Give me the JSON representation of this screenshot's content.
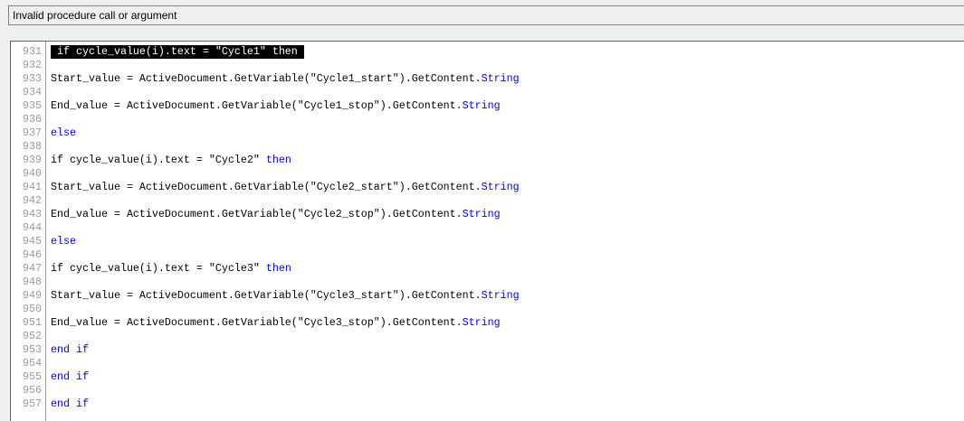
{
  "error_message": "Invalid procedure call or argument",
  "editor": {
    "highlighted_line": 931,
    "lines": [
      {
        "n": "931",
        "hl": true,
        "tokens": [
          {
            "t": " if cycle_value(i).text = \"Cycle1\" then ",
            "k": false
          }
        ]
      },
      {
        "n": "932",
        "tokens": []
      },
      {
        "n": "933",
        "tokens": [
          {
            "t": "Start_value = ActiveDocument.GetVariable(\"Cycle1_start\").GetContent.",
            "k": false
          },
          {
            "t": "String",
            "k": true
          }
        ]
      },
      {
        "n": "934",
        "tokens": []
      },
      {
        "n": "935",
        "tokens": [
          {
            "t": "End_value = ActiveDocument.GetVariable(\"Cycle1_stop\").GetContent.",
            "k": false
          },
          {
            "t": "String",
            "k": true
          }
        ]
      },
      {
        "n": "936",
        "tokens": []
      },
      {
        "n": "937",
        "tokens": [
          {
            "t": "else",
            "k": true
          }
        ]
      },
      {
        "n": "938",
        "tokens": []
      },
      {
        "n": "939",
        "tokens": [
          {
            "t": "if cycle_value(i).text = \"Cycle2\" ",
            "k": false
          },
          {
            "t": "then",
            "k": true
          }
        ]
      },
      {
        "n": "940",
        "tokens": []
      },
      {
        "n": "941",
        "tokens": [
          {
            "t": "Start_value = ActiveDocument.GetVariable(\"Cycle2_start\").GetContent.",
            "k": false
          },
          {
            "t": "String",
            "k": true
          }
        ]
      },
      {
        "n": "942",
        "tokens": []
      },
      {
        "n": "943",
        "tokens": [
          {
            "t": "End_value = ActiveDocument.GetVariable(\"Cycle2_stop\").GetContent.",
            "k": false
          },
          {
            "t": "String",
            "k": true
          }
        ]
      },
      {
        "n": "944",
        "tokens": []
      },
      {
        "n": "945",
        "tokens": [
          {
            "t": "else",
            "k": true
          }
        ]
      },
      {
        "n": "946",
        "tokens": []
      },
      {
        "n": "947",
        "tokens": [
          {
            "t": "if cycle_value(i).text = \"Cycle3\" ",
            "k": false
          },
          {
            "t": "then",
            "k": true
          }
        ]
      },
      {
        "n": "948",
        "tokens": []
      },
      {
        "n": "949",
        "tokens": [
          {
            "t": "Start_value = ActiveDocument.GetVariable(\"Cycle3_start\").GetContent.",
            "k": false
          },
          {
            "t": "String",
            "k": true
          }
        ]
      },
      {
        "n": "950",
        "tokens": []
      },
      {
        "n": "951",
        "tokens": [
          {
            "t": "End_value = ActiveDocument.GetVariable(\"Cycle3_stop\").GetContent.",
            "k": false
          },
          {
            "t": "String",
            "k": true
          }
        ]
      },
      {
        "n": "952",
        "tokens": []
      },
      {
        "n": "953",
        "tokens": [
          {
            "t": "end if",
            "k": true
          }
        ]
      },
      {
        "n": "954",
        "tokens": []
      },
      {
        "n": "955",
        "tokens": [
          {
            "t": "end if",
            "k": true
          }
        ]
      },
      {
        "n": "956",
        "tokens": []
      },
      {
        "n": "957",
        "tokens": [
          {
            "t": "end if",
            "k": true
          }
        ]
      }
    ]
  }
}
